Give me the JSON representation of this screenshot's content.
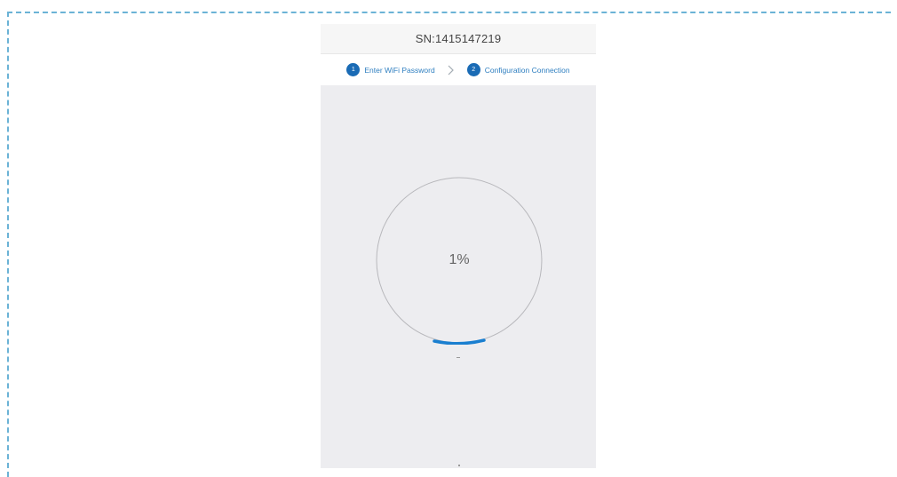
{
  "header": {
    "serial": "SN:1415147219"
  },
  "steps": [
    {
      "number": "1",
      "label": "Enter WiFi Password"
    },
    {
      "number": "2",
      "label": "Configuration Connection"
    }
  ],
  "progress": {
    "text": "1%",
    "value": 0.01
  },
  "colors": {
    "accent": "#1a6bb5",
    "frame_dash": "#6bb3d6",
    "content_bg": "#ededf0"
  },
  "icons": {
    "step_separator": "chevron-right-icon"
  }
}
